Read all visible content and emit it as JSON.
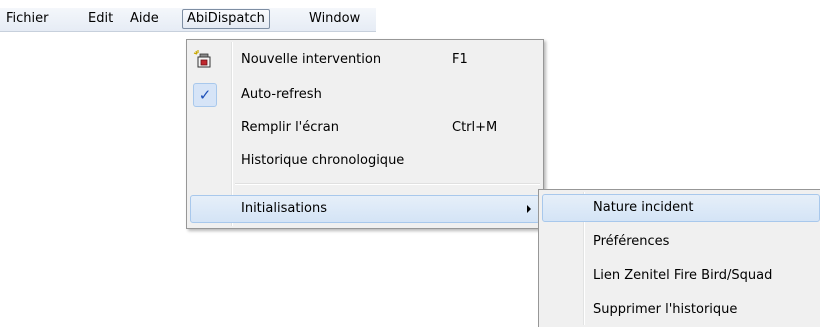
{
  "menubar": {
    "items": [
      {
        "label": "Fichier"
      },
      {
        "label": "Edit"
      },
      {
        "label": "Aide"
      },
      {
        "label": "AbiDispatch"
      },
      {
        "label": "Window"
      }
    ]
  },
  "abidispatch_menu": {
    "items": [
      {
        "label": "Nouvelle intervention",
        "shortcut": "F1",
        "icon": "new-intervention-icon"
      },
      {
        "label": "Auto-refresh",
        "checked": true,
        "icon": "checkmark-icon"
      },
      {
        "label": "Remplir l'écran",
        "shortcut": "Ctrl+M"
      },
      {
        "label": "Historique chronologique"
      },
      {
        "label": "Initialisations",
        "has_submenu": true
      }
    ]
  },
  "initialisations_submenu": {
    "items": [
      {
        "label": "Nature incident"
      },
      {
        "label": "Préférences"
      },
      {
        "label": "Lien Zenitel Fire Bird/Squad"
      },
      {
        "label": "Supprimer l'historique"
      }
    ]
  },
  "icons": {
    "checkmark": "✓"
  },
  "colors": {
    "menubar_bg": "#eaeff6",
    "menu_bg": "#f0f0f0",
    "highlight_bg": "#d9e7f8",
    "highlight_border": "#a8c8ec",
    "check_color": "#1c4fb8"
  }
}
